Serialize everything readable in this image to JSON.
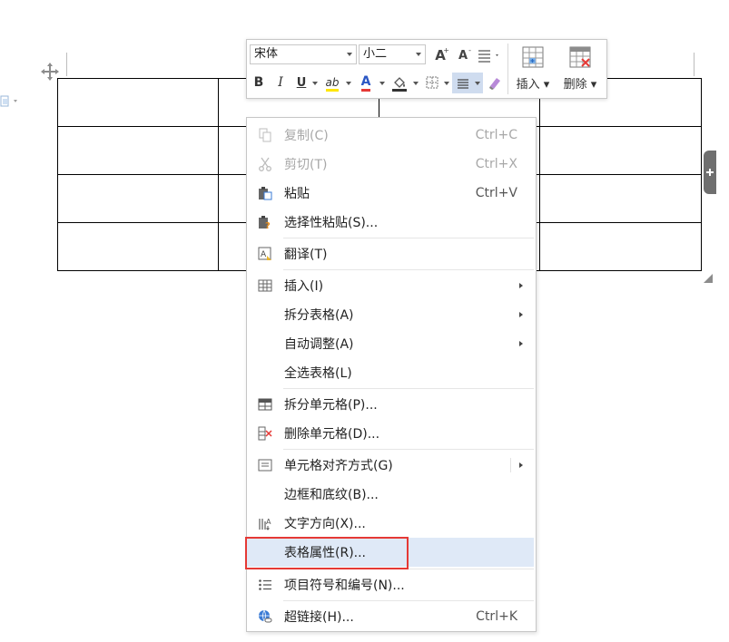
{
  "toolbar": {
    "font_family": "宋体",
    "font_size": "小二",
    "grow_font_label": "A",
    "shrink_font_label": "A",
    "bold_label": "B",
    "italic_label": "I",
    "underline_label": "U",
    "highlight_label": "ab",
    "font_color_label": "A",
    "insert_label": "插入",
    "delete_label": "删除"
  },
  "context_menu": {
    "items": [
      {
        "label": "复制(C)",
        "shortcut": "Ctrl+C",
        "icon": "copy-icon",
        "disabled": true
      },
      {
        "label": "剪切(T)",
        "shortcut": "Ctrl+X",
        "icon": "scissors-icon",
        "disabled": true
      },
      {
        "label": "粘贴",
        "shortcut": "Ctrl+V",
        "icon": "paste-icon"
      },
      {
        "label": "选择性粘贴(S)...",
        "icon": "paste-special-icon"
      },
      {
        "label": "翻译(T)",
        "icon": "translate-icon"
      },
      {
        "label": "插入(I)",
        "icon": "table-icon",
        "submenu": true
      },
      {
        "label": "拆分表格(A)",
        "submenu": true
      },
      {
        "label": "自动调整(A)",
        "submenu": true
      },
      {
        "label": "全选表格(L)"
      },
      {
        "label": "拆分单元格(P)...",
        "icon": "split-cell-icon"
      },
      {
        "label": "删除单元格(D)...",
        "icon": "delete-cell-icon"
      },
      {
        "label": "单元格对齐方式(G)",
        "icon": "cell-align-icon",
        "submenu": true
      },
      {
        "label": "边框和底纹(B)..."
      },
      {
        "label": "文字方向(X)...",
        "icon": "text-direction-icon"
      },
      {
        "label": "表格属性(R)...",
        "highlighted": true
      },
      {
        "label": "项目符号和编号(N)...",
        "icon": "bullet-list-icon"
      },
      {
        "label": "超链接(H)...",
        "shortcut": "Ctrl+K",
        "icon": "hyperlink-icon"
      }
    ]
  },
  "colors": {
    "highlight_row": "#dfe9f7",
    "annotation_box": "#e53935",
    "highlighter_yellow": "#ffe600",
    "font_color_red": "#e53935"
  }
}
